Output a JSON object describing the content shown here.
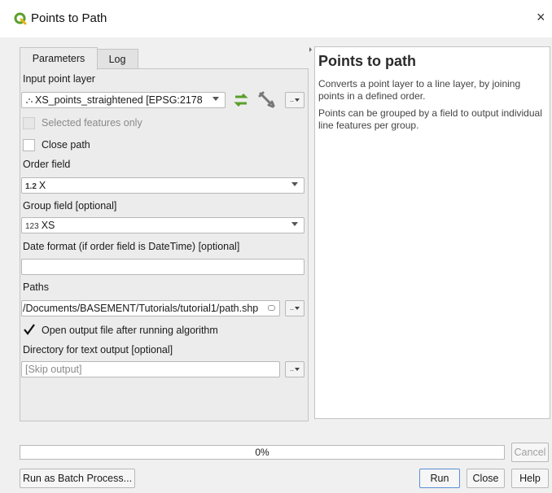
{
  "window": {
    "title": "Points to Path",
    "close_glyph": "×"
  },
  "tabs": [
    {
      "label": "Parameters",
      "active": true
    },
    {
      "label": "Log",
      "active": false
    }
  ],
  "params": {
    "input_layer_label": "Input point layer",
    "input_layer_value": "XS_points_straightened [EPSG:2178",
    "selected_only_label": "Selected features only",
    "close_path_label": "Close path",
    "order_field_label": "Order field",
    "order_field_type": "1.2",
    "order_field_value": "X",
    "group_field_label": "Group field [optional]",
    "group_field_type": "123",
    "group_field_value": "XS",
    "date_format_label": "Date format (if order field is DateTime) [optional]",
    "date_format_value": "",
    "paths_label": "Paths",
    "paths_value": "/Documents/BASEMENT/Tutorials/tutorial1/path.shp",
    "open_output_label": "Open output file after running algorithm",
    "open_output_checked": true,
    "dir_label": "Directory for text output [optional]",
    "dir_placeholder": "[Skip output]",
    "dots": ".."
  },
  "help": {
    "title": "Points to path",
    "p1": "Converts a point layer to a line layer, by joining points in a defined order.",
    "p2": "Points can be grouped by a field to output individual line features per group."
  },
  "progress": {
    "text": "0%",
    "value": 0
  },
  "buttons": {
    "cancel": "Cancel",
    "batch": "Run as Batch Process...",
    "run": "Run",
    "close": "Close",
    "help": "Help"
  },
  "colors": {
    "qgis_green": "#5aa02c",
    "link_blue": "#5a8fd6"
  }
}
